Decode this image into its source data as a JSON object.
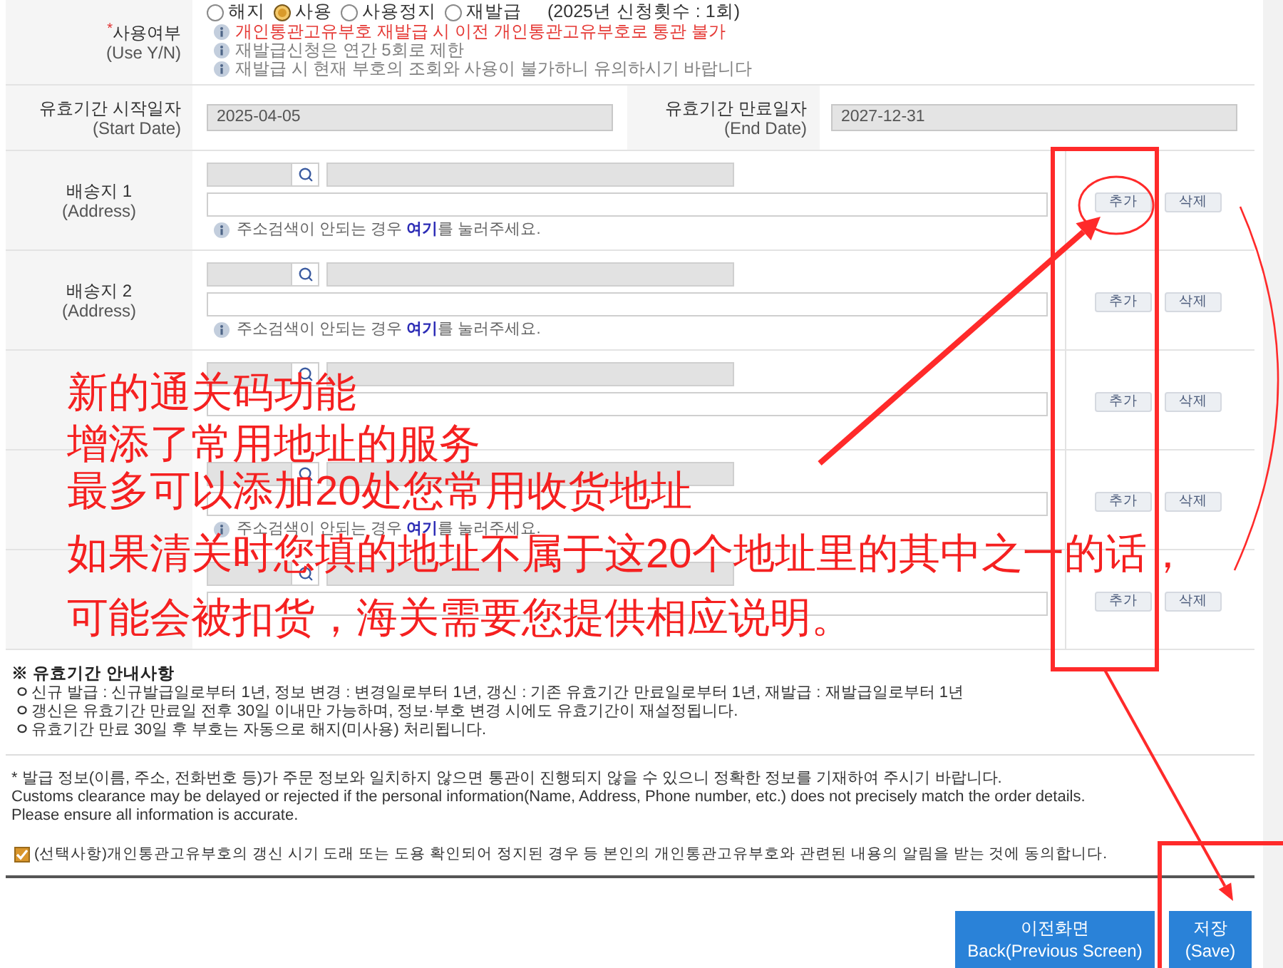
{
  "use_status": {
    "mark": "*",
    "label": "사용여부",
    "sublabel": "(Use Y/N)",
    "options": [
      {
        "label": "해지",
        "selected": false
      },
      {
        "label": "사용",
        "selected": true
      },
      {
        "label": "사용정지",
        "selected": false
      },
      {
        "label": "재발급",
        "selected": false
      }
    ],
    "count_note": "(2025년 신청횟수 : 1회)",
    "notices": [
      {
        "kind": "warning",
        "text": "개인통관고유부호 재발급 시 이전 개인통관고유부호로 통관 불가"
      },
      {
        "kind": "info",
        "text": "재발급신청은 연간 5회로 제한"
      },
      {
        "kind": "info",
        "text": "재발급 시 현재 부호의 조회와 사용이 불가하니 유의하시기 바랍니다"
      }
    ]
  },
  "validity": {
    "start": {
      "label": "유효기간 시작일자",
      "sublabel": "(Start Date)",
      "value": "2025-04-05"
    },
    "end": {
      "label": "유효기간 만료일자",
      "sublabel": "(End Date)",
      "value": "2027-12-31"
    }
  },
  "addresses": [
    {
      "label": "배송지 1",
      "sublabel": "(Address)",
      "hint": {
        "before": "주소검색이 안되는 경우 ",
        "link": "여기",
        "after": "를 눌러주세요."
      },
      "buttons": [
        "추가",
        "삭제"
      ]
    },
    {
      "label": "배송지 2",
      "sublabel": "(Address)",
      "hint": {
        "before": "주소검색이 안되는 경우 ",
        "link": "여기",
        "after": "를 눌러주세요."
      },
      "buttons": [
        "추가",
        "삭제"
      ]
    },
    {
      "buttons": [
        "추가",
        "삭제"
      ]
    },
    {
      "hint": {
        "before": "주소검색이 안되는 경우 ",
        "link": "여기",
        "after": "를 눌러주세요."
      },
      "buttons": [
        "추가",
        "삭제"
      ]
    },
    {
      "buttons": [
        "추가",
        "삭제"
      ]
    }
  ],
  "validity_notes": {
    "title": "※ 유효기간 안내사항",
    "items": [
      {
        "bullet": "ㅇ",
        "text": "신규 발급 : 신규발급일로부터 1년, 정보 변경 : 변경일로부터 1년, 갱신 : 기존 유효기간 만료일로부터 1년, 재발급 : 재발급일로부터 1년"
      },
      {
        "bullet": "ㅇ",
        "text": "갱신은 유효기간 만료일 전후 30일 이내만 가능하며, 정보·부호 변경 시에도 유효기간이 재설정됩니다."
      },
      {
        "bullet": "ㅇ",
        "text": "유효기간 만료 30일 후 부호는 자동으로 해지(미사용) 처리됩니다."
      }
    ]
  },
  "notice": [
    "* 발급 정보(이름, 주소, 전화번호 등)가 주문 정보와 일치하지 않으면 통관이 진행되지 않을 수 있으니 정확한 정보를 기재하여 주시기 바랍니다.",
    "Customs clearance may be delayed or rejected if the personal information(Name, Address, Phone number, etc.) does not precisely match the order details.",
    "Please ensure all information is accurate."
  ],
  "consent": {
    "checked": true,
    "text": "(선택사항)개인통관고유부호의 갱신 시기 도래 또는 도용 확인되어 정지된 경우 등 본인의 개인통관고유부호와 관련된 내용의 알림을 받는 것에 동의합니다."
  },
  "buttons": [
    {
      "kind": "back",
      "label": "이전화면",
      "sublabel": "Back(Previous Screen)"
    },
    {
      "kind": "save",
      "label": "저장",
      "sublabel": "(Save)"
    }
  ],
  "annotation": {
    "lines": [
      "新的通关码功能",
      "增添了常用地址的服务",
      "最多可以添加20处您常用收货地址",
      "如果清关时您填的地址不属于这20个地址里的其中之一的话，",
      "可能会被扣货，海关需要您提供相应说明。"
    ]
  }
}
